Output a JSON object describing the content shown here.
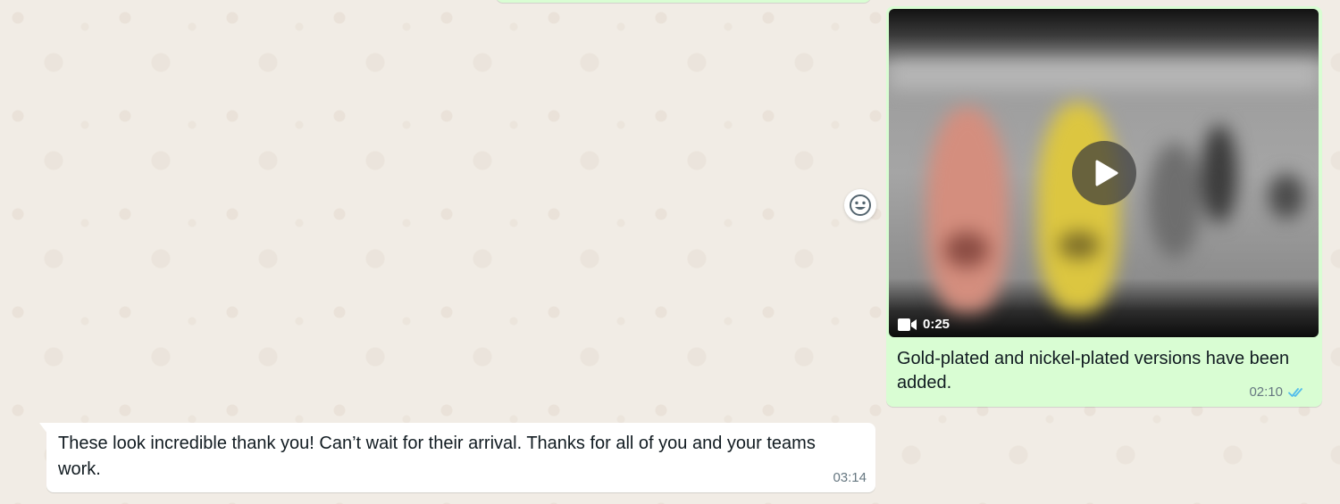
{
  "messages": {
    "outgoing_video": {
      "duration": "0:25",
      "caption": "Gold-plated and nickel-plated versions have been added.",
      "time": "02:10",
      "status": "read"
    },
    "incoming": {
      "text": "These look incredible thank you! Can’t wait for their arrival. Thanks for all of you and your teams work.",
      "time": "03:14"
    }
  },
  "icons": {
    "play": "play-icon",
    "video": "video-camera-icon",
    "read_receipt": "double-check-icon",
    "emoji": "smiley-icon"
  },
  "colors": {
    "outgoing_bubble": "#d9fdd3",
    "incoming_bubble": "#ffffff",
    "read_tick": "#53bdeb",
    "meta_text": "#667781"
  }
}
